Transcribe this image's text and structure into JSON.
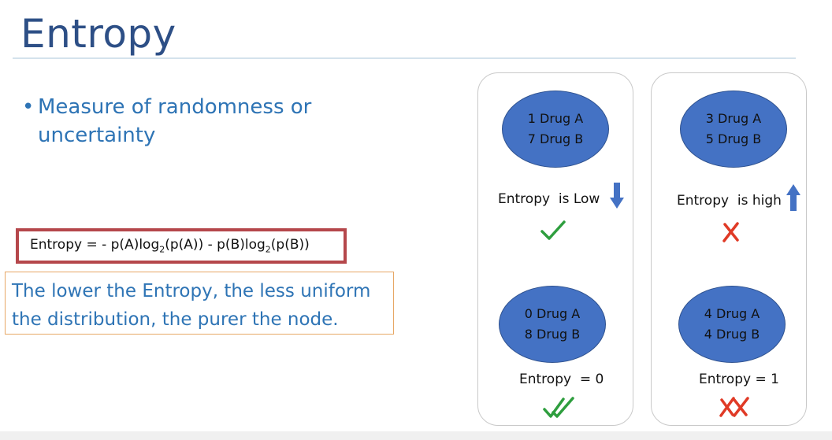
{
  "slide": {
    "title": "Entropy",
    "bullet": {
      "dot": "•",
      "text": "Measure of randomness or uncertainty"
    },
    "formula": {
      "p1": "Entropy = - p(A)log",
      "sub1": "2",
      "p2": "(p(A)) - p(B)log",
      "sub2": "2",
      "p3": "(p(B))"
    },
    "note": "The lower the Entropy, the less uniform the distribution, the purer the node."
  },
  "panels": {
    "left": {
      "top_node": {
        "line1": "1 Drug A",
        "line2": "7 Drug B"
      },
      "top_label": "Entropy  is Low",
      "top_arrow_icon": "arrow-down-icon",
      "top_mark_icon": "check-icon",
      "bottom_node": {
        "line1": "0 Drug A",
        "line2": "8 Drug B"
      },
      "bottom_label": "Entropy  = 0",
      "bottom_mark_icon": "double-check-icon"
    },
    "right": {
      "top_node": {
        "line1": "3 Drug A",
        "line2": "5 Drug B"
      },
      "top_label": "Entropy  is high",
      "top_arrow_icon": "arrow-up-icon",
      "top_mark_icon": "cross-icon",
      "bottom_node": {
        "line1": "4 Drug A",
        "line2": "4 Drug B"
      },
      "bottom_label": "Entropy = 1",
      "bottom_mark_icon": "double-cross-icon"
    }
  },
  "colors": {
    "title": "#2d4f86",
    "accent_blue": "#2e74b5",
    "node_fill": "#4472c4",
    "formula_border": "#b5474b",
    "note_border": "#e7a765",
    "check_green": "#2e9e3e",
    "cross_red": "#e03a26"
  }
}
